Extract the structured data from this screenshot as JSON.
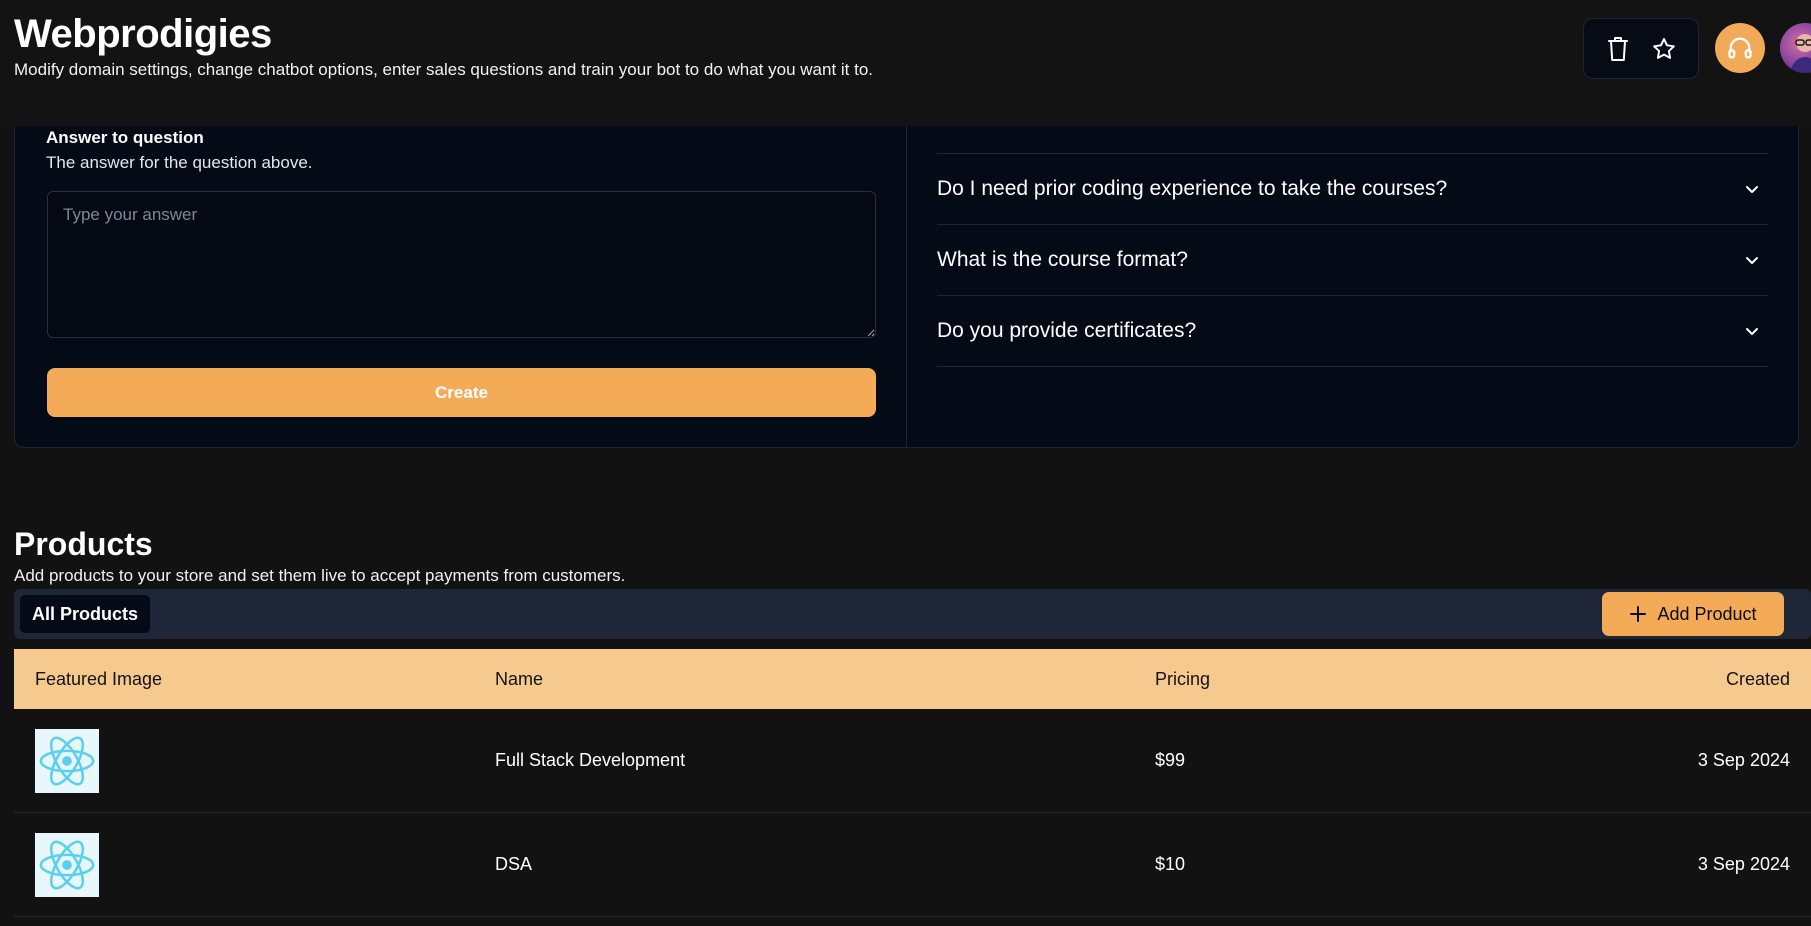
{
  "header": {
    "title": "Webprodigies",
    "subtitle": "Modify domain settings, change chatbot options, enter sales questions and train your bot to do what you want it to.",
    "icons": [
      "trash-icon",
      "star-icon",
      "headphones-icon"
    ]
  },
  "faq_form": {
    "answer_label": "Answer to question",
    "answer_description": "The answer for the question above.",
    "answer_placeholder": "Type your answer",
    "answer_value": "",
    "create_label": "Create"
  },
  "faq_list": {
    "items": [
      {
        "question": "Do I need prior coding experience to take the courses?"
      },
      {
        "question": "What is the course format?"
      },
      {
        "question": "Do you provide certificates?"
      }
    ]
  },
  "products": {
    "title": "Products",
    "description": "Add products to your store and set them live to accept payments from customers.",
    "tab_all": "All Products",
    "add_label": "Add Product",
    "columns": [
      "Featured Image",
      "Name",
      "Pricing",
      "Created"
    ],
    "rows": [
      {
        "image": "react-atom-icon",
        "name": "Full Stack Development",
        "price": "$99",
        "created": "3 Sep 2024"
      },
      {
        "image": "react-atom-icon",
        "name": "DSA",
        "price": "$10",
        "created": "3 Sep 2024"
      }
    ]
  },
  "colors": {
    "accent": "#f3ab57",
    "table_header": "#f6c98f",
    "card_bg": "#050a17",
    "page_bg": "#121212"
  }
}
